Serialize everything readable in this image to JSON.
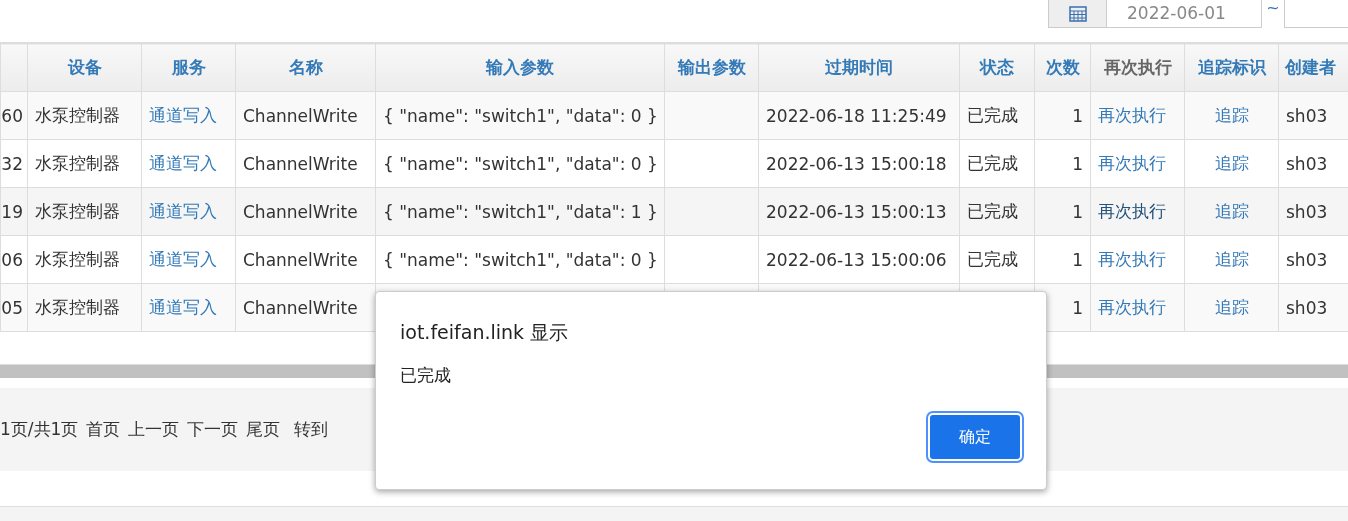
{
  "date_filter": {
    "start": "2022-06-01",
    "separator": "~"
  },
  "table": {
    "columns": [
      {
        "label": "设备",
        "sortable": true
      },
      {
        "label": "服务",
        "sortable": true
      },
      {
        "label": "名称",
        "sortable": true
      },
      {
        "label": "输入参数",
        "sortable": true
      },
      {
        "label": "输出参数",
        "sortable": true
      },
      {
        "label": "过期时间",
        "sortable": true
      },
      {
        "label": "状态",
        "sortable": true
      },
      {
        "label": "次数",
        "sortable": true
      },
      {
        "label": "再次执行",
        "sortable": false
      },
      {
        "label": "追踪标识",
        "sortable": true
      },
      {
        "label": "创建者",
        "sortable": true
      }
    ],
    "rows": [
      {
        "hovered": false,
        "id": "60",
        "device": "水泵控制器",
        "service": "通道写入",
        "name": "ChannelWrite",
        "input": "{ \"name\": \"switch1\", \"data\": 0 }",
        "expires": "2022-06-18 11:25:49",
        "status": "已完成",
        "count": "1",
        "rerun": "再次执行",
        "trace": "追踪",
        "creator": "sh03"
      },
      {
        "hovered": false,
        "id": "32",
        "device": "水泵控制器",
        "service": "通道写入",
        "name": "ChannelWrite",
        "input": "{ \"name\": \"switch1\", \"data\": 0 }",
        "expires": "2022-06-13 15:00:18",
        "status": "已完成",
        "count": "1",
        "rerun": "再次执行",
        "trace": "追踪",
        "creator": "sh03"
      },
      {
        "hovered": true,
        "id": "19",
        "device": "水泵控制器",
        "service": "通道写入",
        "name": "ChannelWrite",
        "input": "{ \"name\": \"switch1\", \"data\": 1 }",
        "expires": "2022-06-13 15:00:13",
        "status": "已完成",
        "count": "1",
        "rerun": "再次执行",
        "trace": "追踪",
        "creator": "sh03"
      },
      {
        "hovered": false,
        "id": "06",
        "device": "水泵控制器",
        "service": "通道写入",
        "name": "ChannelWrite",
        "input": "{ \"name\": \"switch1\", \"data\": 0 }",
        "expires": "2022-06-13 15:00:06",
        "status": "已完成",
        "count": "1",
        "rerun": "再次执行",
        "trace": "追踪",
        "creator": "sh03"
      },
      {
        "hovered": false,
        "id": "05",
        "device": "水泵控制器",
        "service": "通道写入",
        "name": "ChannelWrite",
        "count": "1",
        "rerun": "再次执行",
        "trace": "追踪",
        "creator": "sh03"
      }
    ]
  },
  "pager": {
    "info": "1页/共1页",
    "links": [
      "首页",
      "上一页",
      "下一页",
      "尾页"
    ],
    "goto": "转到"
  },
  "dialog": {
    "title": "iot.feifan.link 显示",
    "message": "已完成",
    "button": "确定"
  }
}
